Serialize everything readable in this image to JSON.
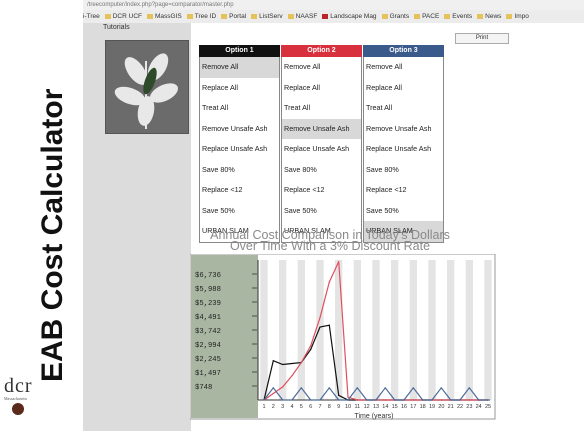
{
  "slide": {
    "title": "EAB Cost Calculator",
    "logo_text": "dcr",
    "logo_subtext": "Massachusetts"
  },
  "browser": {
    "url": "/treecomputer/index.php?page=comparator/master.php",
    "bookmarks": [
      {
        "label": "i-Tree",
        "icon": "none"
      },
      {
        "label": "DCR UCF",
        "icon": "web-icon"
      },
      {
        "label": "MassGIS",
        "icon": "web-icon"
      },
      {
        "label": "Tree ID",
        "icon": "folder-icon"
      },
      {
        "label": "Portal",
        "icon": "star-icon"
      },
      {
        "label": "ListServ",
        "icon": "web-icon"
      },
      {
        "label": "NAASF",
        "icon": "doc-icon"
      },
      {
        "label": "Landscape Mag",
        "icon": "red-icon"
      },
      {
        "label": "Grants",
        "icon": "folder-icon"
      },
      {
        "label": "PACE",
        "icon": "folder-icon"
      },
      {
        "label": "Events",
        "icon": "folder-icon"
      },
      {
        "label": "News",
        "icon": "folder-icon"
      },
      {
        "label": "Impo",
        "icon": "folder-icon"
      }
    ]
  },
  "app": {
    "tutorials_label": "Tutorials",
    "print_label": "Print",
    "options": [
      {
        "header": "Option 1",
        "color": "#111111",
        "items": [
          "Remove All",
          "Replace All",
          "Treat All",
          "Remove Unsafe Ash",
          "Replace Unsafe Ash",
          "Save 80%",
          "Replace <12",
          "Save 50%",
          "URBAN SLAM"
        ],
        "selected_index": 0
      },
      {
        "header": "Option 2",
        "color": "#d9303e",
        "items": [
          "Remove All",
          "Replace All",
          "Treat All",
          "Remove Unsafe Ash",
          "Replace Unsafe Ash",
          "Save 80%",
          "Replace <12",
          "Save 50%",
          "URBAN SLAM"
        ],
        "selected_index": 3
      },
      {
        "header": "Option 3",
        "color": "#3a5a8c",
        "items": [
          "Remove All",
          "Replace All",
          "Treat All",
          "Remove Unsafe Ash",
          "Replace Unsafe Ash",
          "Save 80%",
          "Replace <12",
          "Save 50%",
          "URBAN SLAM"
        ],
        "selected_index": 8
      }
    ]
  },
  "chart_data": {
    "type": "line",
    "title": "Annual Cost Comparison in Today's Dollars",
    "subtitle": "Over Time With a 3% Discount Rate",
    "xlabel": "Time (years)",
    "ylabel": "",
    "x": [
      1,
      2,
      3,
      4,
      5,
      6,
      7,
      8,
      9,
      10,
      11,
      12,
      13,
      14,
      15,
      16,
      17,
      18,
      19,
      20,
      21,
      22,
      23,
      24,
      25
    ],
    "y_ticks": [
      "$748",
      "$1,497",
      "$2,245",
      "$2,994",
      "$3,742",
      "$4,491",
      "$5,239",
      "$5,988",
      "$6,736"
    ],
    "ylim": [
      0,
      7484
    ],
    "grid": true,
    "series": [
      {
        "color": "#111111",
        "values": [
          0,
          2100,
          1900,
          1950,
          2000,
          2700,
          3900,
          4000,
          250,
          0,
          0,
          0,
          0,
          0,
          0,
          0,
          0,
          0,
          0,
          0,
          0,
          0,
          0,
          0,
          0
        ]
      },
      {
        "color": "#e05060",
        "values": [
          0,
          350,
          700,
          1300,
          2000,
          2900,
          4400,
          6300,
          7400,
          150,
          0,
          0,
          0,
          0,
          0,
          0,
          0,
          0,
          0,
          0,
          0,
          0,
          0,
          0,
          0
        ]
      },
      {
        "color": "#4a6a9a",
        "values": [
          0,
          650,
          0,
          0,
          650,
          0,
          0,
          650,
          0,
          0,
          650,
          0,
          0,
          650,
          0,
          0,
          650,
          0,
          0,
          650,
          0,
          0,
          650,
          0,
          0
        ]
      }
    ]
  }
}
